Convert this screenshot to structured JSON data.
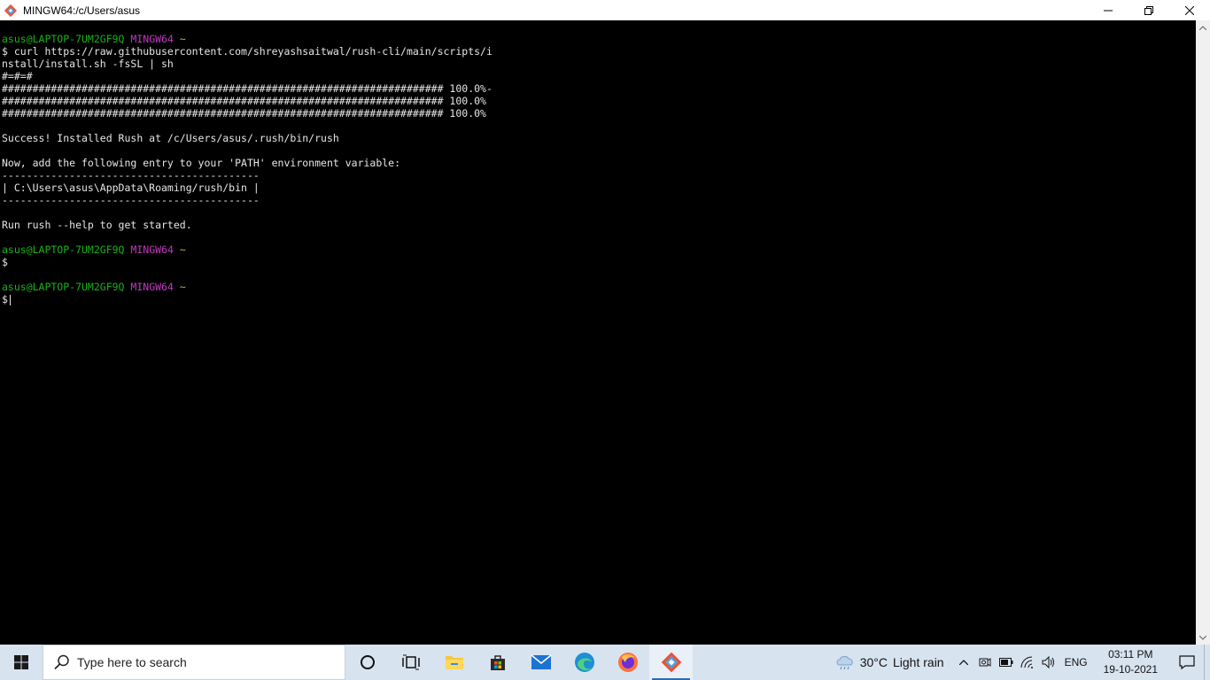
{
  "window": {
    "title": "MINGW64:/c/Users/asus",
    "controls": [
      "minimize",
      "restore",
      "close"
    ]
  },
  "terminal": {
    "lines": [
      {
        "segments": [
          {
            "text": "asus@LAPTOP-7UM2GF9Q",
            "color": "user"
          },
          {
            "text": " "
          },
          {
            "text": "MINGW64",
            "color": "sys"
          },
          {
            "text": " "
          },
          {
            "text": "~",
            "color": "path"
          }
        ]
      },
      {
        "segments": [
          {
            "text": "$ curl https://raw.githubusercontent.com/shreyashsaitwal/rush-cli/main/scripts/i"
          }
        ]
      },
      {
        "segments": [
          {
            "text": "nstall/install.sh -fsSL | sh"
          }
        ]
      },
      {
        "segments": [
          {
            "text": "#=#=#"
          }
        ]
      },
      {
        "segments": [
          {
            "text": "######################################################################## 100.0%-"
          }
        ]
      },
      {
        "segments": [
          {
            "text": "######################################################################## 100.0%"
          }
        ]
      },
      {
        "segments": [
          {
            "text": "######################################################################## 100.0%"
          }
        ]
      },
      {
        "segments": [
          {
            "text": ""
          }
        ]
      },
      {
        "segments": [
          {
            "text": "Success! Installed Rush at /c/Users/asus/.rush/bin/rush"
          }
        ]
      },
      {
        "segments": [
          {
            "text": ""
          }
        ]
      },
      {
        "segments": [
          {
            "text": "Now, add the following entry to your 'PATH' environment variable:"
          }
        ]
      },
      {
        "segments": [
          {
            "text": "------------------------------------------"
          }
        ]
      },
      {
        "segments": [
          {
            "text": "| C:\\Users\\asus\\AppData\\Roaming/rush/bin |"
          }
        ]
      },
      {
        "segments": [
          {
            "text": "------------------------------------------"
          }
        ]
      },
      {
        "segments": [
          {
            "text": ""
          }
        ]
      },
      {
        "segments": [
          {
            "text": "Run rush --help to get started."
          }
        ]
      },
      {
        "segments": [
          {
            "text": ""
          }
        ]
      },
      {
        "segments": [
          {
            "text": "asus@LAPTOP-7UM2GF9Q",
            "color": "user"
          },
          {
            "text": " "
          },
          {
            "text": "MINGW64",
            "color": "sys"
          },
          {
            "text": " "
          },
          {
            "text": "~",
            "color": "path"
          }
        ]
      },
      {
        "segments": [
          {
            "text": "$"
          }
        ]
      },
      {
        "segments": [
          {
            "text": ""
          }
        ]
      },
      {
        "segments": [
          {
            "text": "asus@LAPTOP-7UM2GF9Q",
            "color": "user"
          },
          {
            "text": " "
          },
          {
            "text": "MINGW64",
            "color": "sys"
          },
          {
            "text": " "
          },
          {
            "text": "~",
            "color": "path"
          }
        ]
      },
      {
        "segments": [
          {
            "text": "$"
          }
        ],
        "cursor": true
      }
    ],
    "colors": {
      "user": "#17b317",
      "sys": "#c238c2",
      "path": "#c8b42b",
      "text": "#e6e6e6",
      "background": "#000000"
    }
  },
  "taskbar": {
    "search_placeholder": "Type here to search",
    "pinned": [
      "cortana-icon",
      "task-view-icon",
      "file-explorer-icon",
      "microsoft-store-icon",
      "mail-icon",
      "edge-icon",
      "firefox-icon",
      "git-bash-icon"
    ],
    "active_app": "git-bash-icon",
    "weather": {
      "temp": "30°C",
      "condition": "Light rain"
    },
    "language": "ENG",
    "clock": {
      "time": "03:11 PM",
      "date": "19-10-2021"
    }
  }
}
